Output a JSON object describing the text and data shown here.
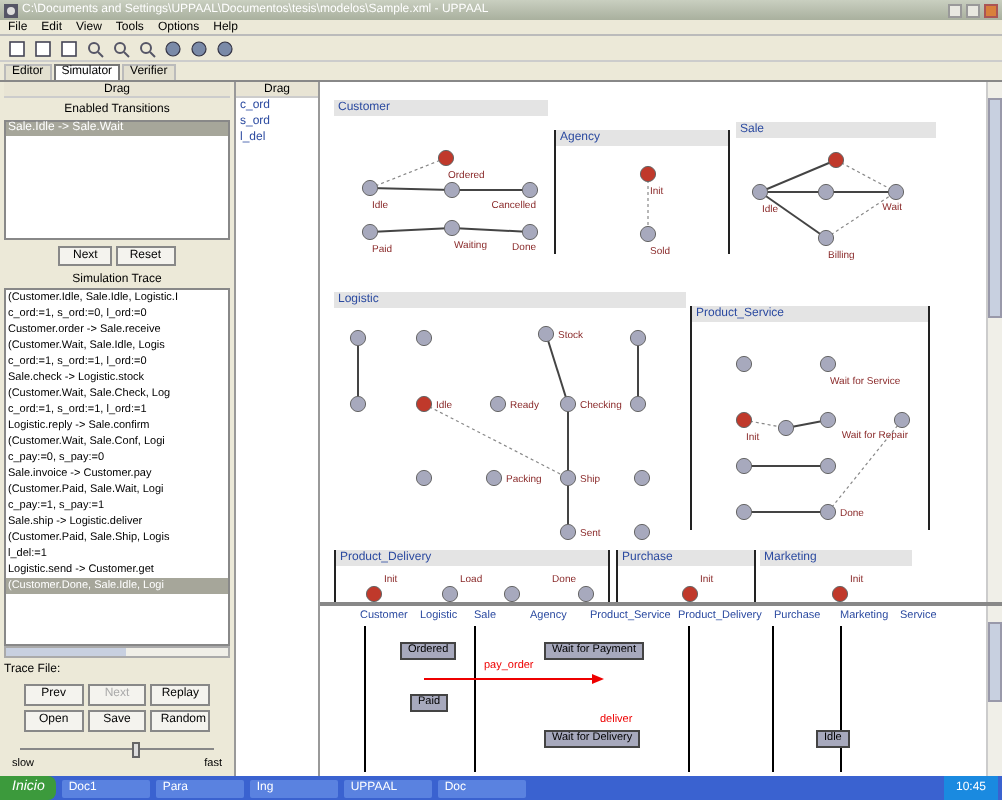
{
  "window": {
    "title": "C:\\Documents and Settings\\UPPAAL\\Documentos\\tesis\\modelos\\Sample.xml - UPPAAL"
  },
  "menu": [
    "File",
    "Edit",
    "View",
    "Tools",
    "Options",
    "Help"
  ],
  "tabs": [
    {
      "label": "Editor",
      "selected": false
    },
    {
      "label": "Simulator",
      "selected": true
    },
    {
      "label": "Verifier",
      "selected": false
    }
  ],
  "left_panel": {
    "header": "Drag",
    "transitions_title": "Enabled Transitions",
    "transitions": [
      {
        "label": "Sale.Idle -> Sale.Wait",
        "selected": true
      }
    ],
    "buttons": [
      "Next",
      "Reset"
    ],
    "trace_title": "Simulation Trace",
    "trace": [
      {
        "label": "(Customer.Idle, Sale.Idle, Logistic.I",
        "selected": false
      },
      {
        "label": "c_ord:=1, s_ord:=0, l_ord:=0",
        "selected": false
      },
      {
        "label": "Customer.order -> Sale.receive",
        "selected": false
      },
      {
        "label": "(Customer.Wait, Sale.Idle, Logis",
        "selected": false
      },
      {
        "label": "c_ord:=1, s_ord:=1, l_ord:=0",
        "selected": false
      },
      {
        "label": "Sale.check -> Logistic.stock",
        "selected": false
      },
      {
        "label": "(Customer.Wait, Sale.Check, Log",
        "selected": false
      },
      {
        "label": "c_ord:=1, s_ord:=1, l_ord:=1",
        "selected": false
      },
      {
        "label": "Logistic.reply -> Sale.confirm",
        "selected": false
      },
      {
        "label": "(Customer.Wait, Sale.Conf, Logi",
        "selected": false
      },
      {
        "label": "c_pay:=0, s_pay:=0",
        "selected": false
      },
      {
        "label": "Sale.invoice -> Customer.pay",
        "selected": false
      },
      {
        "label": "(Customer.Paid, Sale.Wait, Logi",
        "selected": false
      },
      {
        "label": "c_pay:=1, s_pay:=1",
        "selected": false
      },
      {
        "label": "Sale.ship -> Logistic.deliver",
        "selected": false
      },
      {
        "label": "(Customer.Paid, Sale.Ship, Logis",
        "selected": false
      },
      {
        "label": "l_del:=1",
        "selected": false
      },
      {
        "label": "Logistic.send -> Customer.get",
        "selected": false
      },
      {
        "label": "(Customer.Done, Sale.Idle, Logi",
        "selected": true
      }
    ],
    "trace_file_label": "Trace File:",
    "trace_buttons": [
      {
        "label": "Prev",
        "disabled": false
      },
      {
        "label": "Next",
        "disabled": true
      },
      {
        "label": "Replay",
        "disabled": false
      },
      {
        "label": "Open",
        "disabled": false
      },
      {
        "label": "Save",
        "disabled": false
      },
      {
        "label": "Random",
        "disabled": false
      }
    ],
    "speed": {
      "level": 0.6,
      "min_label": "slow",
      "max_label": "fast"
    }
  },
  "variables": {
    "header": "Drag",
    "items": [
      "c_ord",
      "s_ord",
      "l_del"
    ]
  },
  "automata": [
    {
      "title": "Customer",
      "nodes": [
        {
          "label": "Idle",
          "current": false
        },
        {
          "current": false
        },
        {
          "label": "Cancelled",
          "current": false
        },
        {
          "label": "Ordered",
          "current": true
        },
        {
          "label": "Paid",
          "current": false
        },
        {
          "label": "Waiting",
          "current": false
        },
        {
          "label": "Done",
          "current": false
        }
      ]
    },
    {
      "title": "Agency",
      "nodes": [
        {
          "label": "Init",
          "current": true
        },
        {
          "label": "Sold",
          "current": false
        }
      ]
    },
    {
      "title": "Sale",
      "nodes": [
        {
          "current": true
        },
        {
          "label": "Idle",
          "current": false
        },
        {
          "current": false
        },
        {
          "label": "Wait",
          "current": false
        },
        {
          "label": "Billing",
          "current": false
        }
      ]
    },
    {
      "title": "Logistic",
      "nodes": [
        {
          "current": false
        },
        {
          "current": false
        },
        {
          "label": "Stock",
          "current": false
        },
        {
          "current": false
        },
        {
          "current": false
        },
        {
          "label": "Idle",
          "current": true
        },
        {
          "label": "Ready",
          "current": false
        },
        {
          "label": "Checking",
          "current": false
        },
        {
          "current": false
        },
        {
          "current": false
        },
        {
          "label": "Packing",
          "current": false
        },
        {
          "label": "Ship",
          "current": false
        },
        {
          "current": false
        },
        {
          "label": "Sent",
          "current": false
        },
        {
          "current": false
        }
      ]
    },
    {
      "title": "Product_Service",
      "nodes": [
        {
          "current": false
        },
        {
          "label": "Wait for Service",
          "current": false
        },
        {
          "label": "Init",
          "current": true
        },
        {
          "current": false
        },
        {
          "current": false
        },
        {
          "label": "Wait for Repair",
          "current": false
        },
        {
          "current": false
        },
        {
          "current": false
        },
        {
          "current": false
        },
        {
          "label": "Done",
          "current": false
        }
      ]
    },
    {
      "title": "Product_Delivery",
      "nodes": [
        {
          "label": "Init",
          "current": true
        },
        {
          "label": "Load",
          "current": false
        },
        {
          "current": false
        },
        {
          "label": "Done",
          "current": false
        }
      ]
    },
    {
      "title": "Purchase",
      "nodes": [
        {
          "label": "Init",
          "current": true
        }
      ]
    },
    {
      "title": "Marketing",
      "nodes": [
        {
          "label": "Init",
          "current": true
        }
      ]
    }
  ],
  "sequence_chart": {
    "lanes": [
      "Customer",
      "Logistic",
      "Sale",
      "Agency",
      "Product_Service",
      "Product_Delivery",
      "Purchase",
      "Marketing",
      "Service"
    ],
    "boxes": [
      "Ordered",
      "Wait for Payment",
      "Paid",
      "Wait for Delivery",
      "Idle"
    ],
    "messages": [
      "pay_order",
      "deliver"
    ]
  },
  "taskbar": {
    "start": "Inicio",
    "tasks": [
      "Doc1",
      "Para",
      "Ing",
      "UPPAAL",
      "Doc"
    ],
    "clock": "10:45"
  }
}
